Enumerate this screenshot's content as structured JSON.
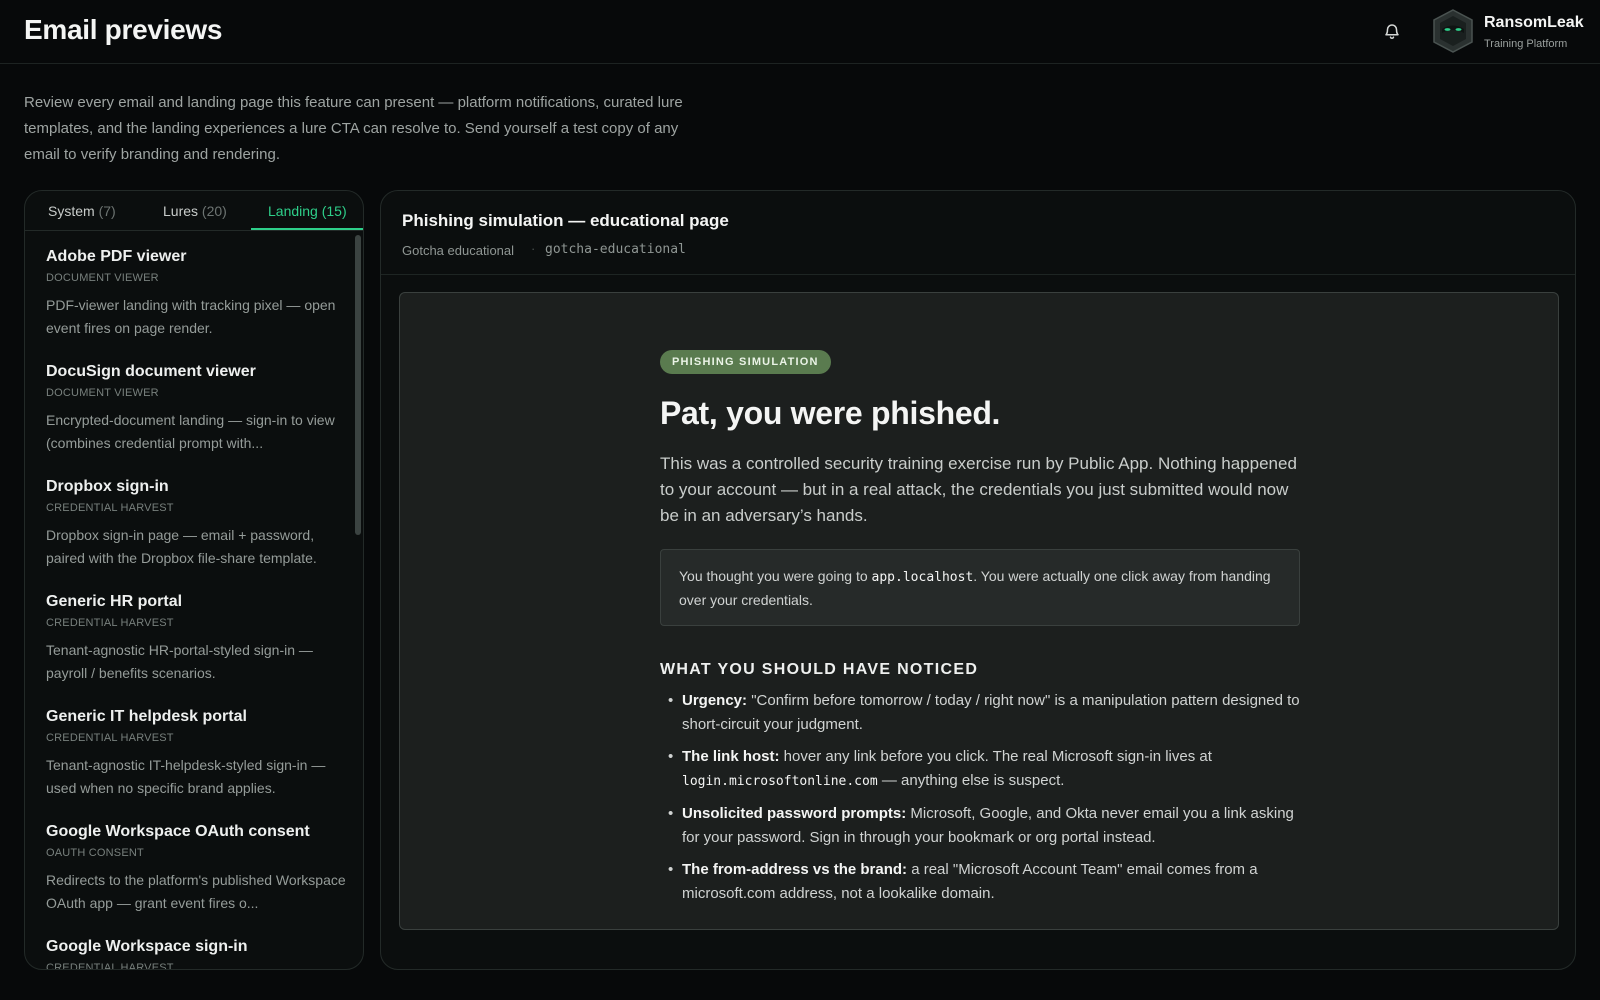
{
  "header": {
    "title": "Email previews",
    "bell_icon": "bell-icon",
    "brand_name": "RansomLeak",
    "brand_sub": "Training Platform"
  },
  "intro": "Review every email and landing page this feature can present — platform notifications, curated lure templates, and the landing experiences a lure CTA can resolve to. Send yourself a test copy of any email to verify branding and rendering.",
  "tabs": [
    {
      "label": "System",
      "count": "(7)"
    },
    {
      "label": "Lures",
      "count": "(20)"
    },
    {
      "label": "Landing",
      "count": "(15)"
    }
  ],
  "active_tab": "Landing",
  "accent_color": "#2ecf8a",
  "items": [
    {
      "title": "Adobe PDF viewer",
      "category": "DOCUMENT VIEWER",
      "desc": "PDF-viewer landing with tracking pixel — open event fires on page render."
    },
    {
      "title": "DocuSign document viewer",
      "category": "DOCUMENT VIEWER",
      "desc": "Encrypted-document landing — sign-in to view (combines credential prompt with..."
    },
    {
      "title": "Dropbox sign-in",
      "category": "CREDENTIAL HARVEST",
      "desc": "Dropbox sign-in page — email + password, paired with the Dropbox file-share template."
    },
    {
      "title": "Generic HR portal",
      "category": "CREDENTIAL HARVEST",
      "desc": "Tenant-agnostic HR-portal-styled sign-in — payroll / benefits scenarios."
    },
    {
      "title": "Generic IT helpdesk portal",
      "category": "CREDENTIAL HARVEST",
      "desc": "Tenant-agnostic IT-helpdesk-styled sign-in — used when no specific brand applies."
    },
    {
      "title": "Google Workspace OAuth consent",
      "category": "OAUTH CONSENT",
      "desc": "Redirects to the platform's published Workspace OAuth app — grant event fires o..."
    },
    {
      "title": "Google Workspace sign-in",
      "category": "CREDENTIAL HARVEST",
      "desc": ""
    }
  ],
  "detail": {
    "title": "Phishing simulation — educational page",
    "subtitle": "Gotcha educational",
    "separator": "·",
    "slug": "gotcha-educational"
  },
  "preview": {
    "badge": "PHISHING SIMULATION",
    "badge_color": "#5a7b4f",
    "headline": "Pat, you were phished.",
    "lead": "This was a controlled security training exercise run by Public App. Nothing happened to your account — but in a real attack, the credentials you just submitted would now be in an adversary’s hands.",
    "callout_before": "You thought you were going to ",
    "callout_host": "app.localhost",
    "callout_after": ". You were actually one click away from handing over your credentials.",
    "notice_heading": "WHAT YOU SHOULD HAVE NOTICED",
    "bullet_glyph": "•",
    "bullets": [
      {
        "label": "Urgency:",
        "text_before": " \"Confirm before tomorrow / today / right now\" is a manipulation pattern designed to short-circuit your judgment.",
        "code": "",
        "text_after": ""
      },
      {
        "label": "The link host:",
        "text_before": " hover any link before you click. The real Microsoft sign-in lives at ",
        "code": "login.microsoftonline.com",
        "text_after": " — anything else is suspect."
      },
      {
        "label": "Unsolicited password prompts:",
        "text_before": " Microsoft, Google, and Okta never email you a link asking for your password. Sign in through your bookmark or org portal instead.",
        "code": "",
        "text_after": ""
      },
      {
        "label": "The from-address vs the brand:",
        "text_before": " a real \"Microsoft Account Team\" email comes from a microsoft.com address, not a lookalike domain.",
        "code": "",
        "text_after": ""
      }
    ]
  }
}
